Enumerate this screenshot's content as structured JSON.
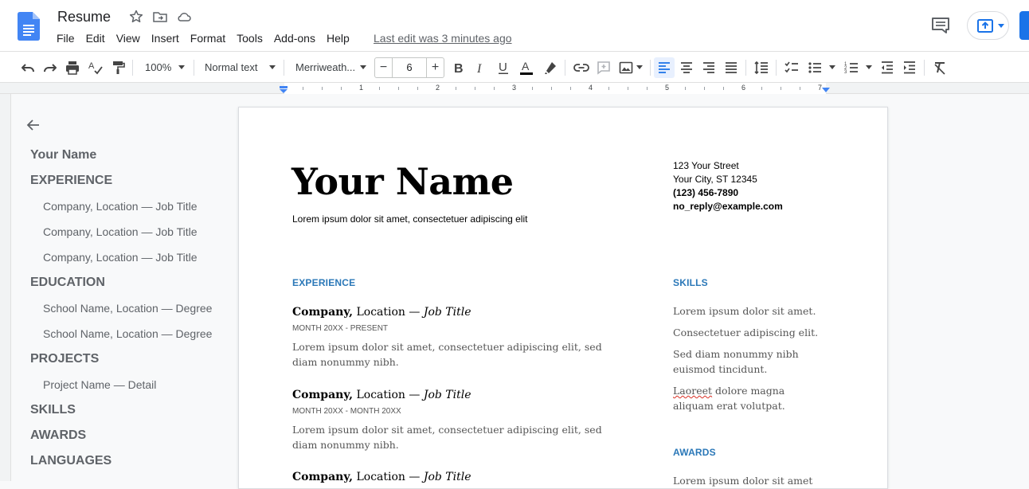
{
  "app": {
    "doc_title": "Resume",
    "menu": [
      "File",
      "Edit",
      "View",
      "Insert",
      "Format",
      "Tools",
      "Add-ons",
      "Help"
    ],
    "last_edit": "Last edit was 3 minutes ago",
    "accent_color": "#1a73e8"
  },
  "toolbar": {
    "zoom": "100%",
    "style": "Normal text",
    "font": "Merriweath...",
    "font_size": "6",
    "minus": "−",
    "plus": "+"
  },
  "ruler": [
    "1",
    "2",
    "3",
    "4",
    "5",
    "6",
    "7"
  ],
  "outline": {
    "items": [
      {
        "label": "Your Name",
        "level": 1
      },
      {
        "label": "EXPERIENCE",
        "level": 1
      },
      {
        "label": "Company, Location — Job Title",
        "level": 2
      },
      {
        "label": "Company, Location — Job Title",
        "level": 2
      },
      {
        "label": "Company, Location — Job Title",
        "level": 2
      },
      {
        "label": "EDUCATION",
        "level": 1
      },
      {
        "label": "School Name, Location — Degree",
        "level": 2
      },
      {
        "label": "School Name, Location — Degree",
        "level": 2
      },
      {
        "label": "PROJECTS",
        "level": 1
      },
      {
        "label": "Project Name — Detail",
        "level": 2
      },
      {
        "label": "SKILLS",
        "level": 1
      },
      {
        "label": "AWARDS",
        "level": 1
      },
      {
        "label": "LANGUAGES",
        "level": 1
      }
    ]
  },
  "document": {
    "name": "Your Name",
    "tagline": "Lorem ipsum dolor sit amet, consectetuer adipiscing elit",
    "contact": {
      "street": "123 Your Street",
      "city": "Your City, ST 12345",
      "phone": "(123) 456-7890",
      "email": "no_reply@example.com"
    },
    "experience": {
      "heading": "EXPERIENCE",
      "jobs": [
        {
          "company": "Company,",
          "location": " Location — ",
          "title": "Job Title",
          "dates": "MONTH 20XX - PRESENT",
          "desc": "Lorem ipsum dolor sit amet, consectetuer adipiscing elit, sed diam nonummy nibh."
        },
        {
          "company": "Company,",
          "location": " Location — ",
          "title": "Job Title",
          "dates": "MONTH 20XX - MONTH 20XX",
          "desc": "Lorem ipsum dolor sit amet, consectetuer adipiscing elit, sed diam nonummy nibh."
        },
        {
          "company": "Company,",
          "location": " Location — ",
          "title": "Job Title"
        }
      ]
    },
    "skills": {
      "heading": "SKILLS",
      "items": [
        "Lorem ipsum dolor sit amet.",
        "Consectetuer adipiscing elit.",
        "Sed diam nonummy nibh euismod tincidunt."
      ],
      "last_item_misspelled": "Laoreet",
      "last_item_rest": " dolore magna aliquam erat volutpat."
    },
    "awards": {
      "heading": "AWARDS",
      "first": "Lorem ipsum dolor sit amet"
    }
  }
}
